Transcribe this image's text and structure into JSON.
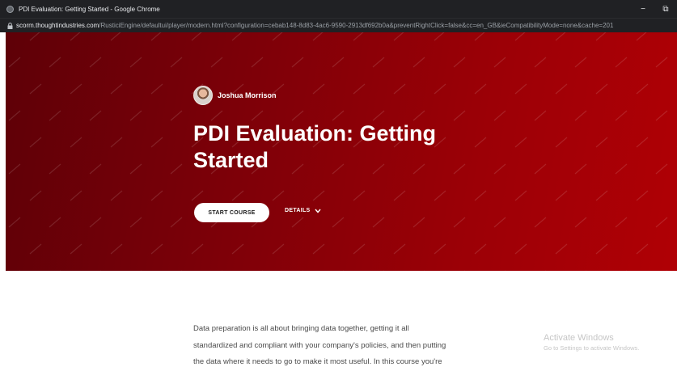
{
  "window": {
    "title": "PDI Evaluation: Getting Started - Google Chrome",
    "controls": {
      "minimize": "−",
      "restore": "⧉"
    }
  },
  "address_bar": {
    "domain": "scorm.thoughtindustries.com",
    "path": "/RusticiEngine/defaultui/player/modern.html?configuration=cebab148-8d83-4ac6-9590-2913df692b0a&preventRightClick=false&cc=en_GB&ieCompatibilityMode=none&cache=201"
  },
  "hero": {
    "colors": {
      "dark": "#5e0007",
      "light": "#b00005"
    },
    "author": "Joshua Morrison",
    "title": "PDI Evaluation: Getting Started",
    "start_label": "START COURSE",
    "details_label": "DETAILS"
  },
  "description": {
    "lines": [
      "Data preparation is all about bringing data together, getting it all",
      "standardized and compliant with your company's policies, and then putting",
      "the data where it needs to go to make it most useful. In this course you're"
    ]
  },
  "watermark": {
    "line1": "Activate Windows",
    "line2": "Go to Settings to activate Windows."
  },
  "icons": {
    "favicon": "chrome-favicon-icon",
    "lock": "lock-icon",
    "details": "chevron-down-icon"
  }
}
